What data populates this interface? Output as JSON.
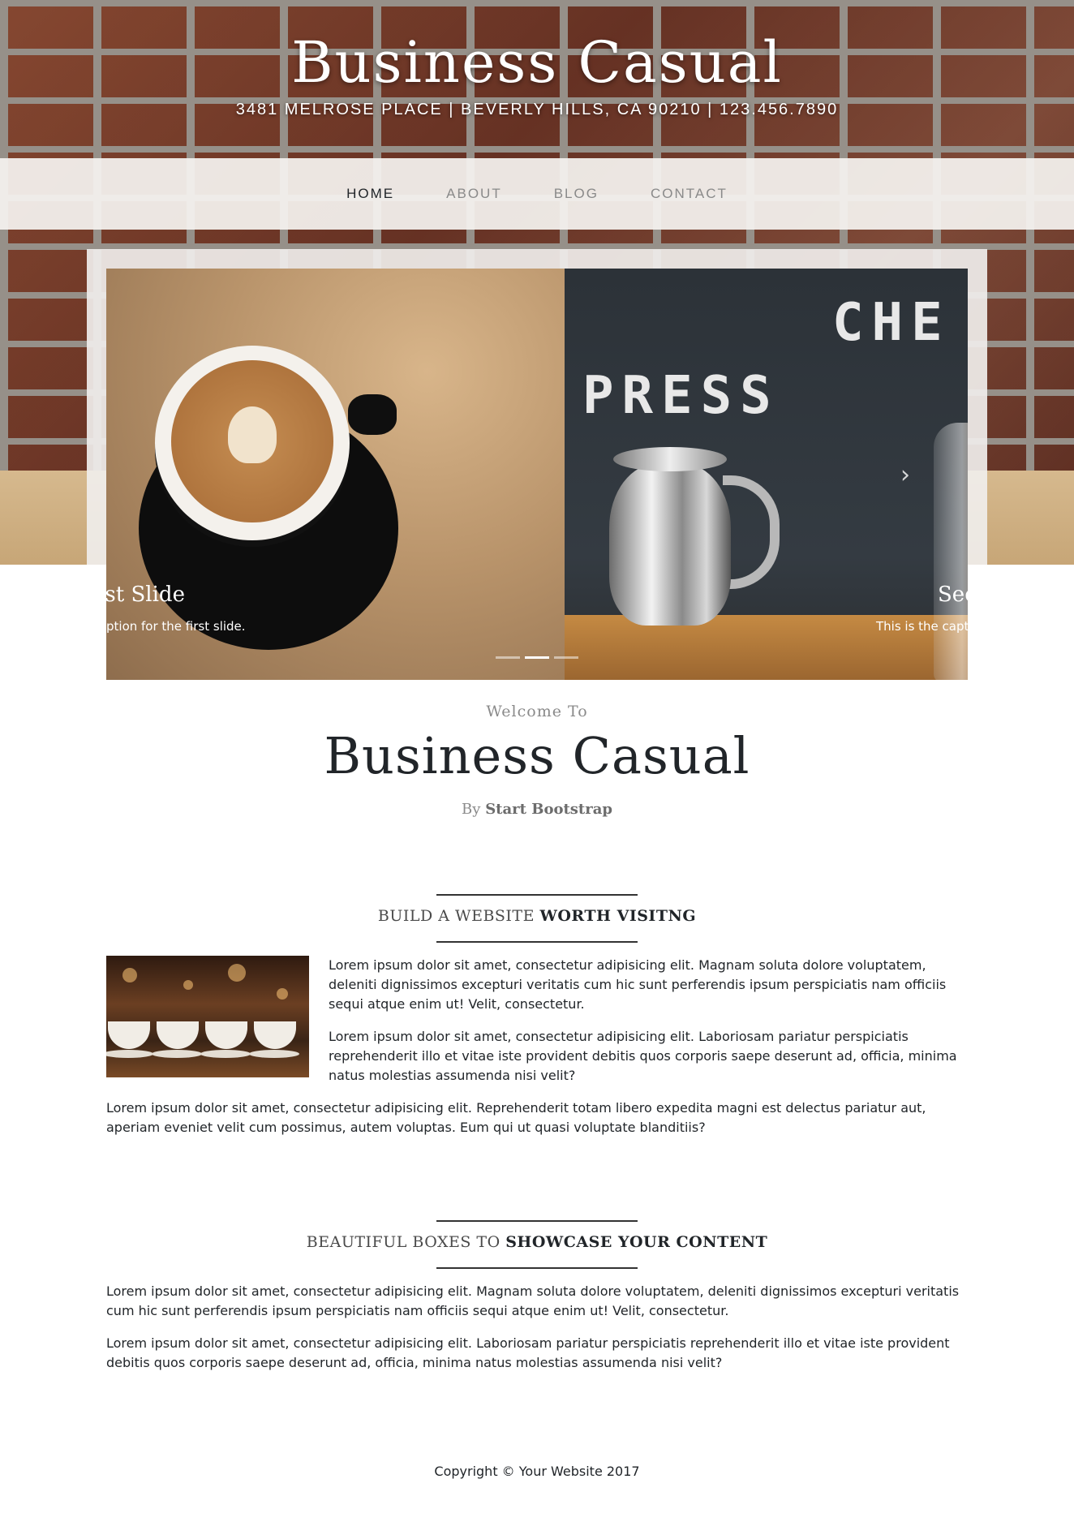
{
  "header": {
    "title": "Business Casual",
    "address": "3481 MELROSE PLACE | BEVERLY HILLS, CA 90210 | 123.456.7890"
  },
  "nav": {
    "items": [
      {
        "label": "HOME",
        "active": true
      },
      {
        "label": "ABOUT",
        "active": false
      },
      {
        "label": "BLOG",
        "active": false
      },
      {
        "label": "CONTACT",
        "active": false
      }
    ]
  },
  "carousel": {
    "slides": [
      {
        "title": "rst Slide",
        "caption": "ption for the first slide."
      },
      {
        "title": "Sec",
        "caption": "This is the capti"
      }
    ],
    "next_icon": "chevron-right-icon",
    "indicators": [
      false,
      true,
      false
    ],
    "right_image_text_1": "PRESS",
    "right_image_text_2": "CHE"
  },
  "welcome": {
    "small": "Welcome To",
    "big": "Business Casual",
    "by_prefix": "By",
    "by_name": "Start Bootstrap"
  },
  "section1": {
    "heading_light": "BUILD A WEBSITE",
    "heading_strong": "WORTH VISITNG",
    "p1": "Lorem ipsum dolor sit amet, consectetur adipisicing elit. Magnam soluta dolore voluptatem, deleniti dignissimos excepturi veritatis cum hic sunt perferendis ipsum perspiciatis nam officiis sequi atque enim ut! Velit, consectetur.",
    "p2": "Lorem ipsum dolor sit amet, consectetur adipisicing elit. Laboriosam pariatur perspiciatis reprehenderit illo et vitae iste provident debitis quos corporis saepe deserunt ad, officia, minima natus molestias assumenda nisi velit?",
    "p3": "Lorem ipsum dolor sit amet, consectetur adipisicing elit. Reprehenderit totam libero expedita magni est delectus pariatur aut, aperiam eveniet velit cum possimus, autem voluptas. Eum qui ut quasi voluptate blanditiis?"
  },
  "section2": {
    "heading_light": "BEAUTIFUL BOXES TO",
    "heading_strong": "SHOWCASE YOUR CONTENT",
    "p1": "Lorem ipsum dolor sit amet, consectetur adipisicing elit. Magnam soluta dolore voluptatem, deleniti dignissimos excepturi veritatis cum hic sunt perferendis ipsum perspiciatis nam officiis sequi atque enim ut! Velit, consectetur.",
    "p2": "Lorem ipsum dolor sit amet, consectetur adipisicing elit. Laboriosam pariatur perspiciatis reprehenderit illo et vitae iste provident debitis quos corporis saepe deserunt ad, officia, minima natus molestias assumenda nisi velit?"
  },
  "footer": {
    "copyright": "Copyright © Your Website 2017"
  }
}
